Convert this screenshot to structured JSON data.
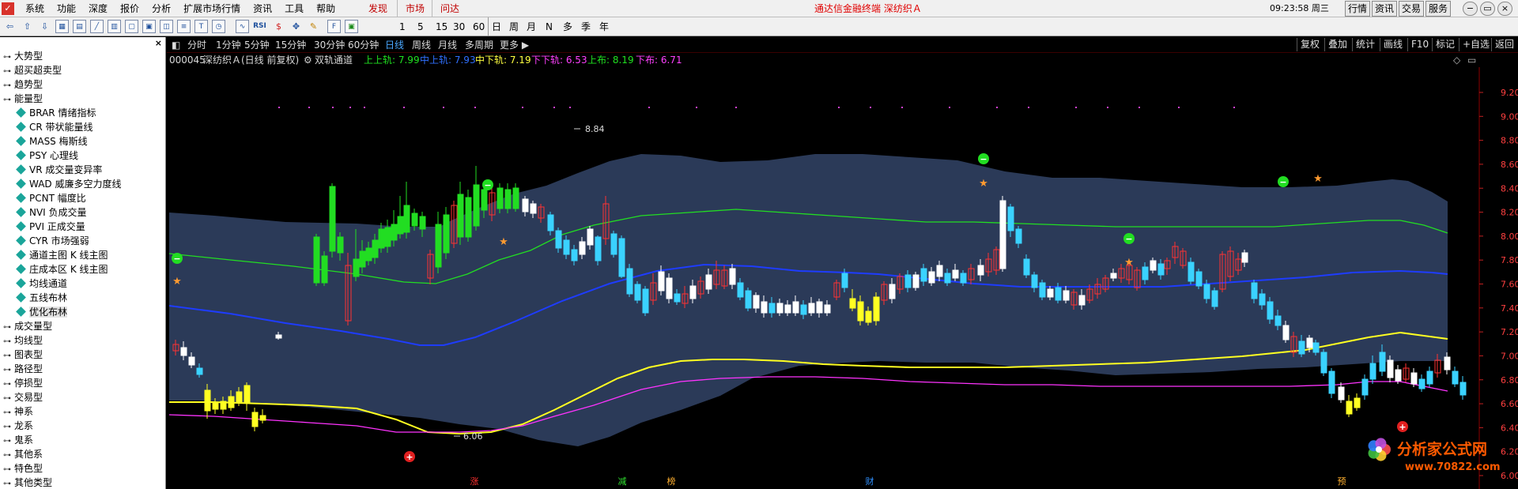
{
  "menubar": {
    "items": [
      "系统",
      "功能",
      "深度",
      "报价",
      "分析",
      "扩展市场行情",
      "资讯",
      "工具",
      "帮助"
    ],
    "discover": "发现",
    "market": "市场",
    "inquiry": "问达",
    "title": "通达信金融终端   深纺织Ａ",
    "clock": "09:23:58 周三",
    "right_buttons": [
      "行情",
      "资讯",
      "交易",
      "服务"
    ],
    "window_controls": [
      "−",
      "▭",
      "×"
    ]
  },
  "toolbar": {
    "periods": [
      "1",
      "5",
      "15",
      "30",
      "60",
      "日",
      "周",
      "月",
      "N",
      "多",
      "季",
      "年"
    ]
  },
  "sidebar": {
    "close": "×",
    "groups_top": [
      "大势型",
      "超买超卖型",
      "趋势型",
      "能量型"
    ],
    "leaves": [
      "BRAR 情绪指标",
      "CR 带状能量线",
      "MASS 梅斯线",
      "PSY 心理线",
      "VR 成交量变异率",
      "WAD 威廉多空力度线",
      "PCNT 幅度比",
      "NVI 负成交量",
      "PVI 正成交量",
      "CYR 市场强弱",
      "通道主图 K 线主图",
      "庄成本区 K 线主图",
      "均线通道",
      "五线布林",
      "优化布林"
    ],
    "selected_leaf": "优化布林",
    "groups_bottom": [
      "成交量型",
      "均线型",
      "图表型",
      "路径型",
      "停损型",
      "交易型",
      "神系",
      "龙系",
      "鬼系",
      "其他系",
      "特色型",
      "其他类型"
    ]
  },
  "chart": {
    "period_tabs": [
      "分时",
      "1分钟",
      "5分钟",
      "15分钟",
      "30分钟",
      "60分钟",
      "日线",
      "周线",
      "月线",
      "多周期",
      "更多 ▶"
    ],
    "active_period": "日线",
    "right_tabs": [
      "复权",
      "叠加",
      "统计",
      "画线",
      "F10",
      "标记",
      "+自选",
      "返回"
    ],
    "stock_code": "000045",
    "stock_name": "深纺织Ａ",
    "mode": "(日线 前复权)",
    "indicator": "双轨通道",
    "legend": [
      {
        "label": "上上轨: 7.99",
        "color": "#20e020"
      },
      {
        "label": "中上轨: 7.93",
        "color": "#3070ff"
      },
      {
        "label": "中下轨: 7.19",
        "color": "#ffff40"
      },
      {
        "label": "下下轨: 6.53",
        "color": "#ff40ff"
      },
      {
        "label": "上布: 8.19",
        "color": "#20e020"
      },
      {
        "label": "下布: 6.71",
        "color": "#ff40ff"
      }
    ],
    "price_axis": [
      "9.20",
      "9.00",
      "8.80",
      "8.60",
      "8.40",
      "8.20",
      "8.00",
      "7.80",
      "7.60",
      "7.40",
      "7.20",
      "7.00",
      "6.80",
      "6.60",
      "6.40",
      "6.20",
      "6.00"
    ],
    "high_label": "8.84",
    "low_label": "6.06",
    "bottom_markers": [
      {
        "text": "涨",
        "color": "#ff3030"
      },
      {
        "text": "减",
        "color": "#30e030"
      },
      {
        "text": "榜",
        "color": "#ffb030"
      },
      {
        "text": "财",
        "color": "#3090ff"
      },
      {
        "text": "预",
        "color": "#ffb030"
      }
    ],
    "watermark_name": "分析家公式网",
    "watermark_url": "www.70822.com",
    "colors": {
      "band": "#2b3a58",
      "up": "#ff3232",
      "down": "#3ad2ff",
      "green_band": "#22dd22",
      "yellow_band": "#ffff22",
      "pink_band": "#ff33ff"
    }
  }
}
